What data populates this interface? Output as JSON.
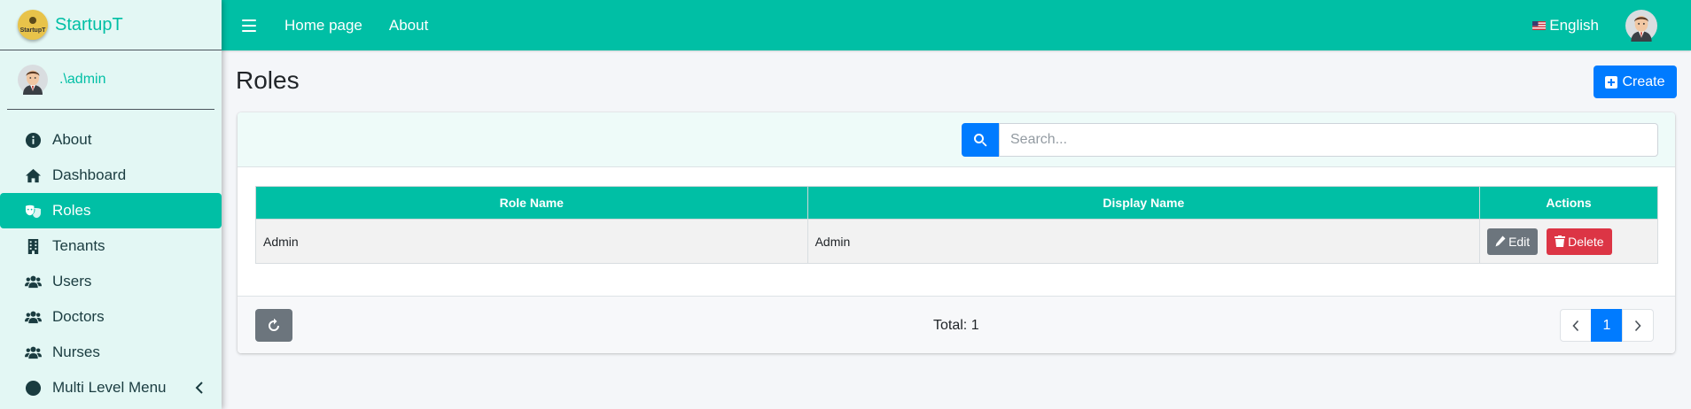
{
  "brand": {
    "name": "StartupT",
    "logo_text": "StartupT"
  },
  "user": {
    "name": ".\\admin"
  },
  "sidebar": {
    "items": [
      {
        "label": "About",
        "icon": "info-circle-icon"
      },
      {
        "label": "Dashboard",
        "icon": "home-icon"
      },
      {
        "label": "Roles",
        "icon": "theater-masks-icon",
        "active": true
      },
      {
        "label": "Tenants",
        "icon": "building-icon"
      },
      {
        "label": "Users",
        "icon": "users-icon"
      },
      {
        "label": "Doctors",
        "icon": "users-icon"
      },
      {
        "label": "Nurses",
        "icon": "users-icon"
      },
      {
        "label": "Multi Level Menu",
        "icon": "circle-icon",
        "has_submenu": true
      }
    ]
  },
  "header": {
    "links": [
      "Home page",
      "About"
    ],
    "language": "English"
  },
  "page": {
    "title": "Roles",
    "create_label": "Create"
  },
  "search": {
    "placeholder": "Search..."
  },
  "table": {
    "columns": [
      "Role Name",
      "Display Name",
      "Actions"
    ],
    "rows": [
      {
        "role_name": "Admin",
        "display_name": "Admin"
      }
    ],
    "edit_label": "Edit",
    "delete_label": "Delete"
  },
  "footer": {
    "total": "Total: 1",
    "pages": [
      "1"
    ],
    "current_page": "1"
  },
  "colors": {
    "primary_teal": "#00bfa5",
    "blue": "#007bff",
    "danger": "#dc3545",
    "secondary": "#6c757d",
    "sidebar_bg": "#e3f7f4"
  }
}
